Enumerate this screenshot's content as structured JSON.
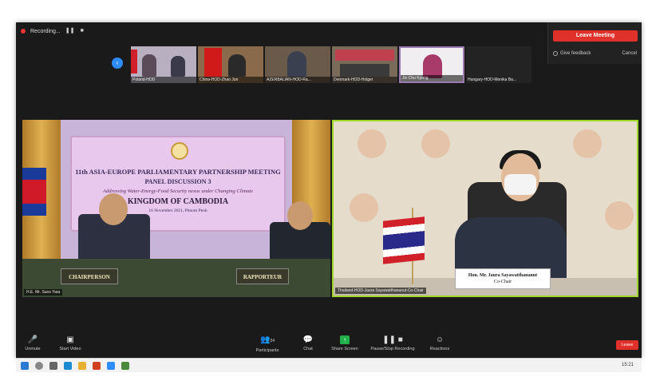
{
  "recording": {
    "label": "Recording..."
  },
  "leave_popup": {
    "leave_label": "Leave Meeting",
    "feedback_label": "Give feedback",
    "cancel_label": "Cancel"
  },
  "filmstrip": {
    "thumbs": [
      {
        "name": "Poland-HOD"
      },
      {
        "name": "China-HOD-Zhao Jun"
      },
      {
        "name": "AZERBAIJAN-HOD-Ra..."
      },
      {
        "name": "Denmark-HOD-Holger"
      },
      {
        "name": "Jin Chu Kyong"
      },
      {
        "name": "Hungary-HOD-Monika Ba..."
      }
    ]
  },
  "left_video": {
    "banner_line1": "11th ASIA-EUROPE PARLIAMENTARY PARTNERSHIP MEETING",
    "banner_line2": "PANEL DISCUSSION 3",
    "banner_line3": "Addressing Water-Energy-Food Security nexus under Changing Climate",
    "banner_line4": "KINGDOM OF CAMBODIA",
    "banner_line5": "16 November 2021, Phnom Penh",
    "chairperson": "CHAIRPERSON",
    "rapporteur": "RAPPORTEUR",
    "caption": "H.E. Mr. Suos Yara"
  },
  "right_video": {
    "nameplate_name": "Hon. Mr. Jaura Sayawatthananut",
    "nameplate_role": "Co-Chair",
    "caption": "Thailand-HOD-Jaura Sayawatthananut-Co-Chair"
  },
  "toolbar": {
    "unmute": "Unmute",
    "start_video": "Start Video",
    "participants": "Participants",
    "participants_count": "24",
    "chat": "Chat",
    "share": "Share Screen",
    "record": "Pause/Stop Recording",
    "reactions": "Reactions",
    "leave": "Leave"
  },
  "taskbar": {
    "time": "15:21"
  }
}
